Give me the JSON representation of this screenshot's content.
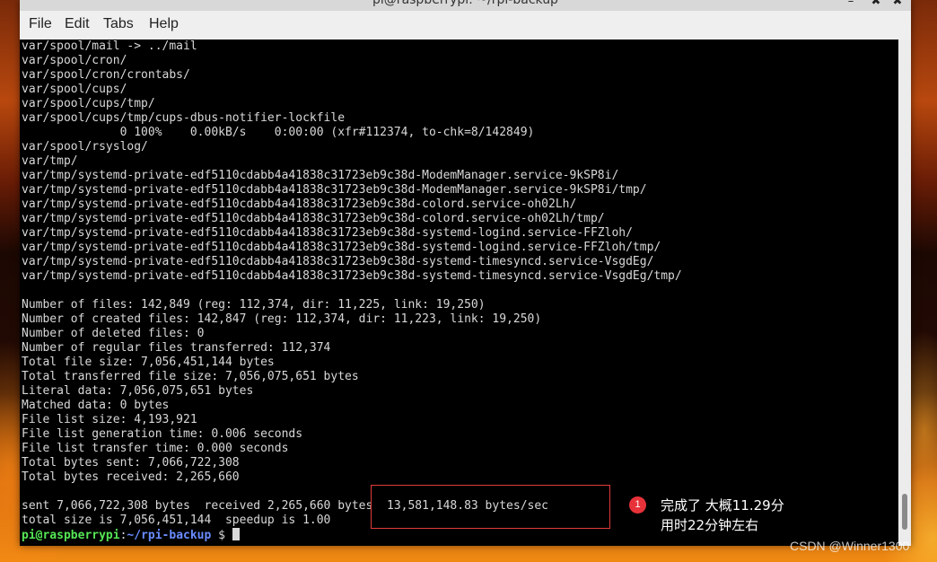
{
  "window": {
    "title": "pi@raspberrypi: ~/rpi-backup",
    "controls": [
      "–",
      "✖",
      "✖"
    ]
  },
  "menu": [
    {
      "label": "File"
    },
    {
      "label": "Edit"
    },
    {
      "label": "Tabs"
    },
    {
      "label": "Help"
    }
  ],
  "terminal": {
    "lines": [
      "var/spool/mail -> ../mail",
      "var/spool/cron/",
      "var/spool/cron/crontabs/",
      "var/spool/cups/",
      "var/spool/cups/tmp/",
      "var/spool/cups/tmp/cups-dbus-notifier-lockfile",
      "              0 100%    0.00kB/s    0:00:00 (xfr#112374, to-chk=8/142849)",
      "var/spool/rsyslog/",
      "var/tmp/",
      "var/tmp/systemd-private-edf5110cdabb4a41838c31723eb9c38d-ModemManager.service-9kSP8i/",
      "var/tmp/systemd-private-edf5110cdabb4a41838c31723eb9c38d-ModemManager.service-9kSP8i/tmp/",
      "var/tmp/systemd-private-edf5110cdabb4a41838c31723eb9c38d-colord.service-oh02Lh/",
      "var/tmp/systemd-private-edf5110cdabb4a41838c31723eb9c38d-colord.service-oh02Lh/tmp/",
      "var/tmp/systemd-private-edf5110cdabb4a41838c31723eb9c38d-systemd-logind.service-FFZloh/",
      "var/tmp/systemd-private-edf5110cdabb4a41838c31723eb9c38d-systemd-logind.service-FFZloh/tmp/",
      "var/tmp/systemd-private-edf5110cdabb4a41838c31723eb9c38d-systemd-timesyncd.service-VsgdEg/",
      "var/tmp/systemd-private-edf5110cdabb4a41838c31723eb9c38d-systemd-timesyncd.service-VsgdEg/tmp/",
      "",
      "Number of files: 142,849 (reg: 112,374, dir: 11,225, link: 19,250)",
      "Number of created files: 142,847 (reg: 112,374, dir: 11,223, link: 19,250)",
      "Number of deleted files: 0",
      "Number of regular files transferred: 112,374",
      "Total file size: 7,056,451,144 bytes",
      "Total transferred file size: 7,056,075,651 bytes",
      "Literal data: 7,056,075,651 bytes",
      "Matched data: 0 bytes",
      "File list size: 4,193,921",
      "File list generation time: 0.006 seconds",
      "File list transfer time: 0.000 seconds",
      "Total bytes sent: 7,066,722,308",
      "Total bytes received: 2,265,660",
      "",
      "sent 7,066,722,308 bytes  received 2,265,660 bytes  13,581,148.83 bytes/sec",
      "total size is 7,056,451,144  speedup is 1.00"
    ],
    "prompt_user": "pi@raspberrypi",
    "prompt_sep": ":",
    "prompt_path": "~/rpi-backup",
    "prompt_symbol": " $ "
  },
  "annotation": {
    "badge": "1",
    "line1": "完成了 大概11.29分",
    "line2": "用时22分钟左右",
    "color": "#e8323a"
  },
  "watermark": "CSDN @Winner1300"
}
